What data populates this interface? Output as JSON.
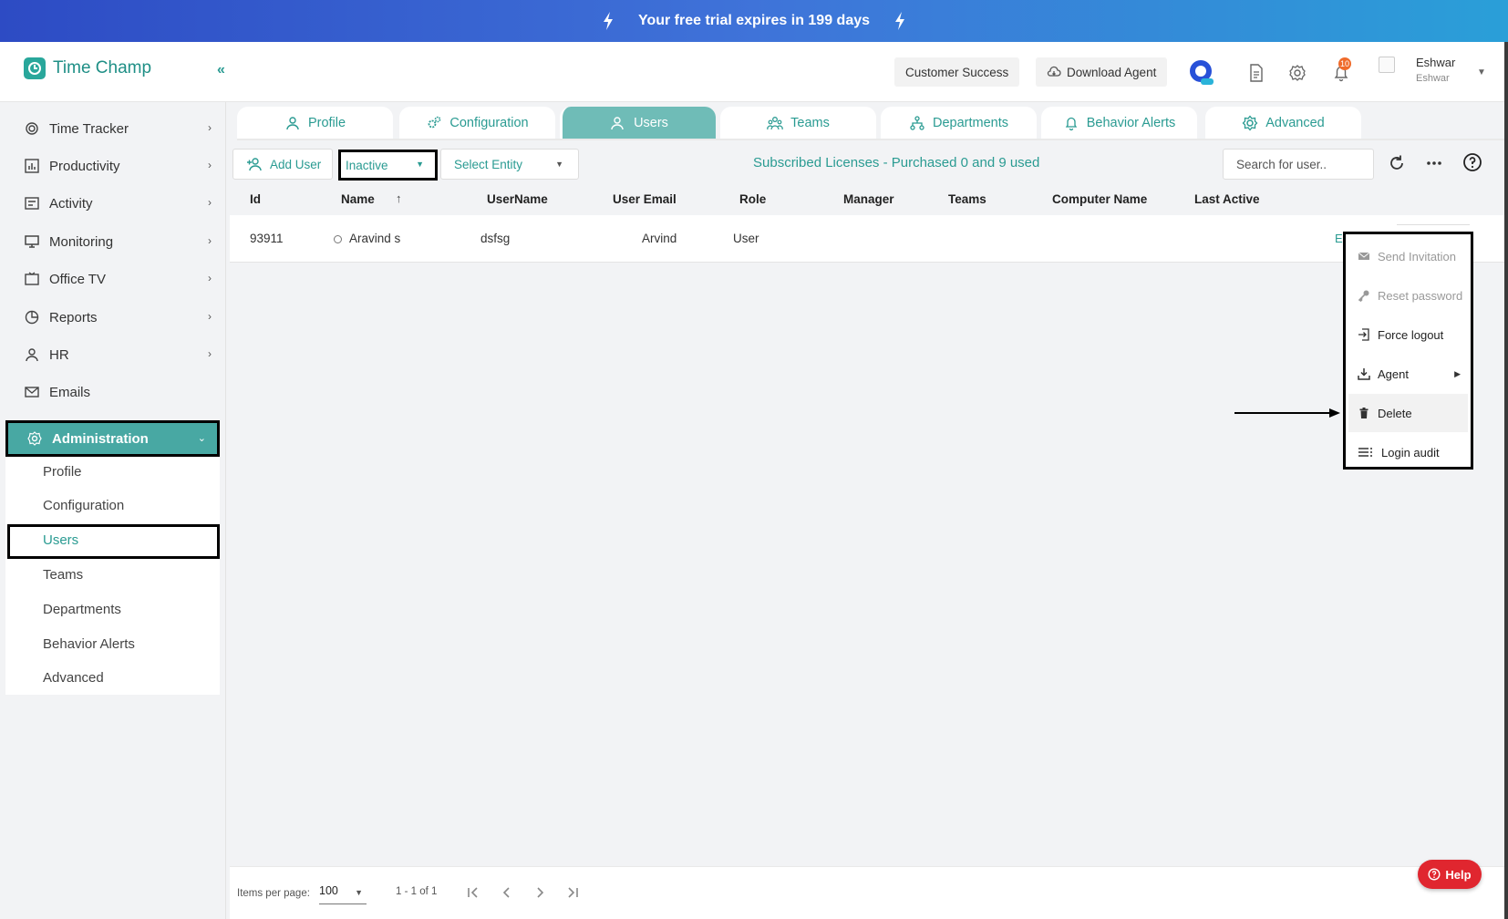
{
  "banner": {
    "text": "Your free trial expires in 199 days"
  },
  "header": {
    "logo_text": "Time Champ",
    "customer_success": "Customer Success",
    "download_agent": "Download Agent",
    "notification_count": "10",
    "user_name": "Eshwar",
    "user_sub": "Eshwar"
  },
  "sidebar": {
    "items": [
      {
        "label": "Time Tracker"
      },
      {
        "label": "Productivity"
      },
      {
        "label": "Activity"
      },
      {
        "label": "Monitoring"
      },
      {
        "label": "Office TV"
      },
      {
        "label": "Reports"
      },
      {
        "label": "HR"
      },
      {
        "label": "Emails"
      }
    ],
    "admin_label": "Administration",
    "sub_items": [
      {
        "label": "Profile"
      },
      {
        "label": "Configuration"
      },
      {
        "label": "Users"
      },
      {
        "label": "Teams"
      },
      {
        "label": "Departments"
      },
      {
        "label": "Behavior Alerts"
      },
      {
        "label": "Advanced"
      }
    ]
  },
  "tabs": [
    {
      "label": "Profile"
    },
    {
      "label": "Configuration"
    },
    {
      "label": "Users"
    },
    {
      "label": "Teams"
    },
    {
      "label": "Departments"
    },
    {
      "label": "Behavior Alerts"
    },
    {
      "label": "Advanced"
    }
  ],
  "toolbar": {
    "add_user": "Add User",
    "status_filter": "Inactive",
    "entity_placeholder": "Select Entity",
    "licenses": "Subscribed Licenses - Purchased 0 and 9 used",
    "search_placeholder": "Search for user.."
  },
  "table": {
    "columns": [
      "Id",
      "Name",
      "UserName",
      "User Email",
      "Role",
      "Manager",
      "Teams",
      "Computer Name",
      "Last Active"
    ],
    "rows": [
      {
        "id": "93911",
        "name": "Aravind s",
        "username": "dsfsg",
        "email": "Arvind",
        "role": "User",
        "manager": "",
        "teams": "",
        "computer": "",
        "last_active": ""
      }
    ],
    "row_edge_text": "E"
  },
  "menu": {
    "items": [
      {
        "label": "Send Invitation"
      },
      {
        "label": "Reset password"
      },
      {
        "label": "Force logout"
      },
      {
        "label": "Agent"
      },
      {
        "label": "Delete"
      },
      {
        "label": "Login audit"
      }
    ]
  },
  "pagination": {
    "items_per_page_label": "Items per page:",
    "items_per_page": "100",
    "range": "1 - 1 of 1"
  },
  "help_label": "Help",
  "colors": {
    "accent": "#2a9b92",
    "active_tab": "#6fbcb7",
    "admin": "#48a8a3",
    "help": "#e0262f"
  }
}
